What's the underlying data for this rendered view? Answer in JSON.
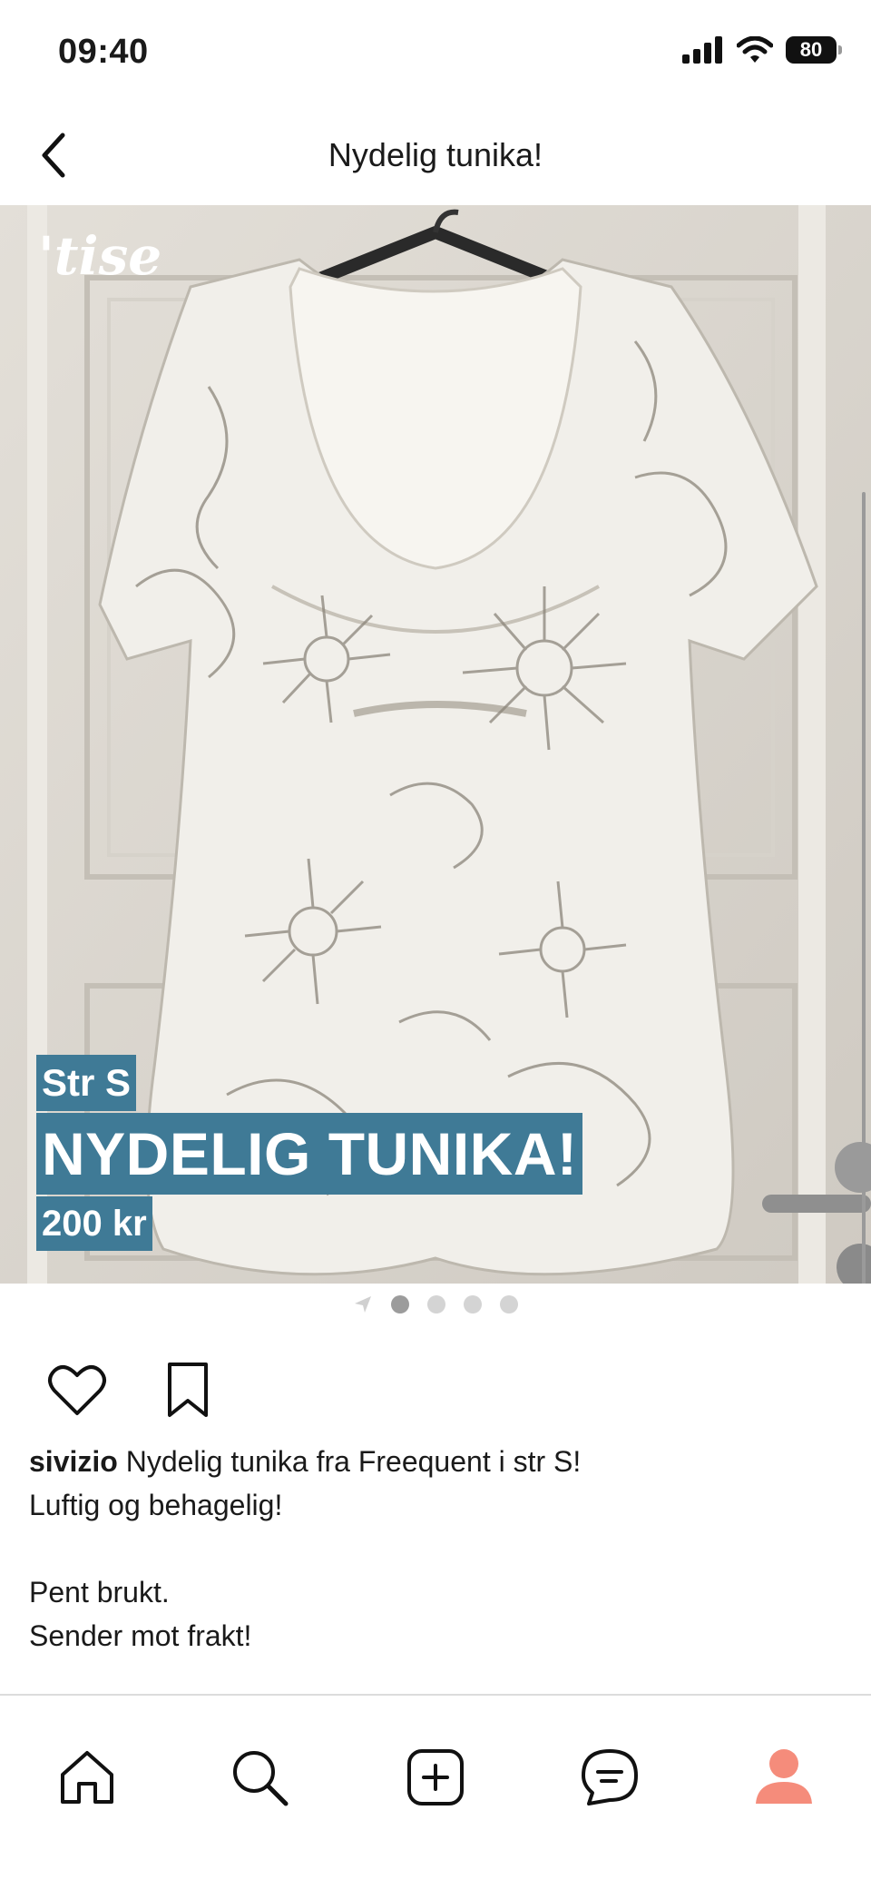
{
  "status_bar": {
    "time": "09:40",
    "battery": "80"
  },
  "header": {
    "title": "Nydelig tunika!",
    "back_icon": "chevron-left-icon"
  },
  "listing": {
    "watermark": "'tise",
    "size_label": "Str S",
    "title": "NYDELIG TUNIKA!",
    "price": "200 kr",
    "image_count": 4,
    "active_image": 1
  },
  "actions": {
    "like_icon": "heart-icon",
    "save_icon": "bookmark-icon"
  },
  "description": {
    "username": "sivizio",
    "lines": [
      "Nydelig tunika fra Freequent i str S!",
      "Luftig og behagelig!",
      "",
      "Pent brukt.",
      "Sender mot frakt!"
    ]
  },
  "tabbar": {
    "items": [
      "home-icon",
      "search-icon",
      "add-icon",
      "messages-icon",
      "profile-icon"
    ],
    "profile_color": "#f58c7b"
  },
  "colors": {
    "accent_overlay": "#3f7a96"
  }
}
